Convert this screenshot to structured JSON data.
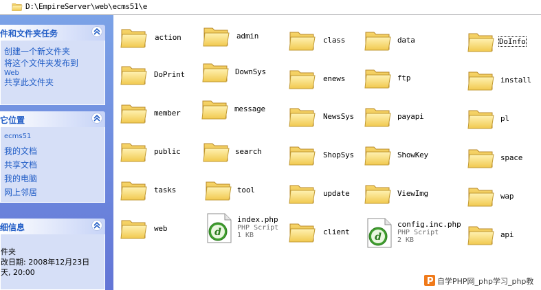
{
  "address_bar": {
    "path": "D:\\EmpireServer\\web\\ecms51\\e"
  },
  "task_pane": {
    "file_tasks": {
      "title": "件和文件夹任务",
      "items": [
        "创建一个新文件夹",
        "将这个文件夹发布到",
        "Web",
        "共享此文件夹"
      ]
    },
    "other_places": {
      "title": "它位置",
      "items": [
        "ecms51",
        "我的文档",
        "共享文档",
        "我的电脑",
        "网上邻居"
      ]
    },
    "details": {
      "title": "细信息",
      "lines": [
        "件夹",
        "改日期: 2008年12月23日",
        "天, 20:00"
      ]
    }
  },
  "files": {
    "folders": [
      "action",
      "admin",
      "class",
      "data",
      "DoInfo",
      "DoPrint",
      "DownSys",
      "enews",
      "ftp",
      "install",
      "member",
      "message",
      "NewsSys",
      "payapi",
      "pl",
      "public",
      "search",
      "ShopSys",
      "ShowKey",
      "space",
      "tasks",
      "tool",
      "update",
      "ViewImg",
      "wap",
      "web",
      "client",
      "api"
    ],
    "php_files": [
      {
        "name": "index.php",
        "type": "PHP Script",
        "size": "1 KB"
      },
      {
        "name": "config.inc.php",
        "type": "PHP Script",
        "size": "2 KB"
      }
    ]
  },
  "watermark": {
    "text": "自学PHP网_php学习_php教"
  },
  "colors": {
    "pane_gradient_top": "#7ba2e7",
    "pane_gradient_bottom": "#6375d6",
    "panel_title": "#215dc6",
    "panel_body": "#d6dff7",
    "folder_yellow": "#f8d66c",
    "php_icon_green": "#3f9e2e"
  },
  "icons": {
    "folder": "folder-icon",
    "php_file": "dreamweaver-php-file-icon",
    "collapse": "chevron-up-double-icon"
  }
}
